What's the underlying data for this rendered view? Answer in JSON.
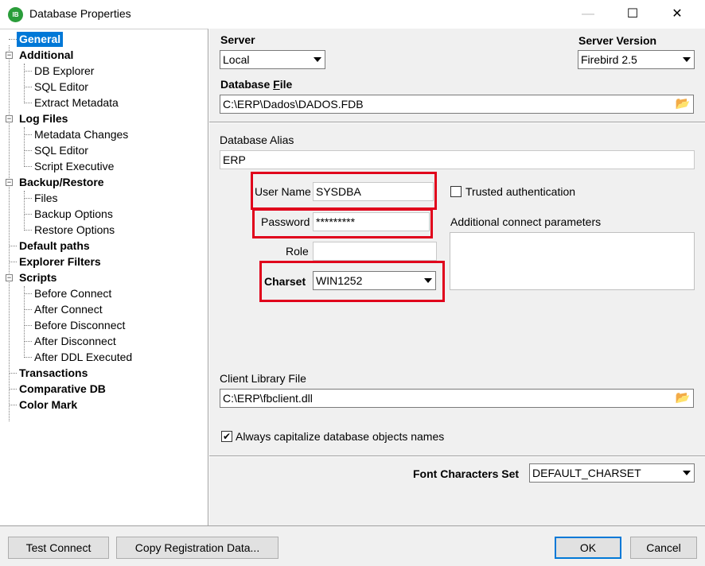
{
  "window": {
    "title": "Database Properties",
    "icon_label": "IB",
    "controls": {
      "minimize": "—",
      "maximize": "☐",
      "close": "✕"
    }
  },
  "tree": {
    "items": [
      {
        "label": "General",
        "bold": true,
        "selected": true
      },
      {
        "label": "Additional",
        "bold": true,
        "children": [
          "DB Explorer",
          "SQL Editor",
          "Extract Metadata"
        ]
      },
      {
        "label": "Log Files",
        "bold": true,
        "children": [
          "Metadata Changes",
          "SQL Editor",
          "Script Executive"
        ]
      },
      {
        "label": "Backup/Restore",
        "bold": true,
        "children": [
          "Files",
          "Backup Options",
          "Restore Options"
        ]
      },
      {
        "label": "Default paths",
        "bold": true
      },
      {
        "label": "Explorer Filters",
        "bold": true
      },
      {
        "label": "Scripts",
        "bold": true,
        "children": [
          "Before Connect",
          "After Connect",
          "Before Disconnect",
          "After Disconnect",
          "After DDL Executed"
        ]
      },
      {
        "label": "Transactions",
        "bold": true
      },
      {
        "label": "Comparative DB",
        "bold": true
      },
      {
        "label": "Color Mark",
        "bold": true
      }
    ],
    "toggle_symbol": "−"
  },
  "general": {
    "server_label": "Server",
    "server_value": "Local",
    "server_version_label": "Server Version",
    "server_version_value": "Firebird 2.5",
    "database_file_label": "Database ",
    "database_file_label_u": "F",
    "database_file_label_rest": "ile",
    "database_file_value": "C:\\ERP\\Dados\\DADOS.FDB",
    "database_alias_label": "Database Alias",
    "database_alias_value": "ERP",
    "user_name_label": "User Name",
    "user_name_value": "SYSDBA",
    "password_label": "Password",
    "password_value": "*********",
    "role_label": "Role",
    "role_value": "",
    "charset_label": "Charset",
    "charset_value": "WIN1252",
    "trusted_auth_label": "Trusted authentication",
    "trusted_auth_checked": false,
    "additional_params_label": "Additional connect parameters",
    "client_library_label": "Client Library File",
    "client_library_value": "C:\\ERP\\fbclient.dll",
    "capitalize_label": "Always capitalize database objects names",
    "capitalize_checked": true,
    "check_mark": "✔",
    "font_charset_label": "Font Characters Set",
    "font_charset_value": "DEFAULT_CHARSET",
    "folder_icon": "📂"
  },
  "buttons": {
    "test_connect": "Test Connect",
    "copy_registration": "Copy Registration Data...",
    "ok": "OK",
    "cancel": "Cancel"
  },
  "colors": {
    "highlight_border": "#e0001b",
    "selection": "#0078d7"
  }
}
